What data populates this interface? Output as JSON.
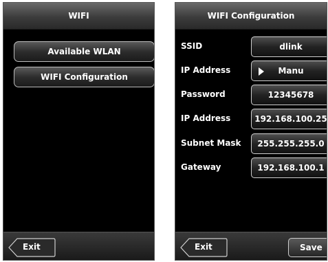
{
  "wifi_screen": {
    "title": "WIFI",
    "menu": [
      {
        "label": "Available WLAN"
      },
      {
        "label": "WIFI Configuration"
      }
    ],
    "exit_label": "Exit"
  },
  "config_screen": {
    "title": "WIFI Configuration",
    "rows": [
      {
        "label": "SSID",
        "value": "dlink"
      },
      {
        "label": "IP Address",
        "value": "Manu",
        "icon": "play-arrow-icon"
      },
      {
        "label": "Password",
        "value": "12345678"
      },
      {
        "label": "IP Address",
        "value": "192.168.100.25"
      },
      {
        "label": "Subnet Mask",
        "value": "255.255.255.0"
      },
      {
        "label": "Gateway",
        "value": "192.168.100.1"
      }
    ],
    "exit_label": "Exit",
    "save_label": "Save"
  }
}
